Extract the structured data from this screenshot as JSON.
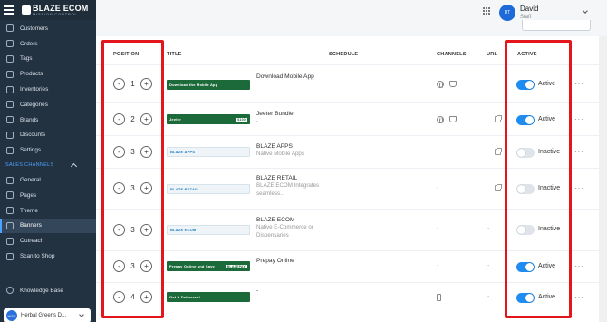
{
  "brand": {
    "name": "BLAZE ECOM",
    "tagline": "MISSION CONTROL"
  },
  "sidebar": {
    "items": [
      {
        "label": "Customers",
        "icon": "customers-icon"
      },
      {
        "label": "Orders",
        "icon": "orders-icon"
      },
      {
        "label": "Tags",
        "icon": "tag-icon"
      },
      {
        "label": "Products",
        "icon": "products-icon"
      },
      {
        "label": "Inventories",
        "icon": "inventory-icon"
      },
      {
        "label": "Categories",
        "icon": "categories-icon"
      },
      {
        "label": "Brands",
        "icon": "brands-icon"
      },
      {
        "label": "Discounts",
        "icon": "discount-icon"
      },
      {
        "label": "Settings",
        "icon": "gear-icon"
      }
    ],
    "section_label": "SALES CHANNELS",
    "channel_items": [
      {
        "label": "General",
        "icon": "general-icon"
      },
      {
        "label": "Pages",
        "icon": "pages-icon"
      },
      {
        "label": "Theme",
        "icon": "theme-icon"
      },
      {
        "label": "Banners",
        "icon": "banners-icon",
        "active": true
      },
      {
        "label": "Outreach",
        "icon": "outreach-icon"
      },
      {
        "label": "Scan to Shop",
        "icon": "scan-icon"
      }
    ],
    "knowledge_base": "Knowledge Base",
    "store": {
      "initials": "HGD",
      "name": "Herbal Greens D..."
    }
  },
  "header": {
    "user_initials": "DT",
    "user_name": "David",
    "user_role": "Staff"
  },
  "table": {
    "columns": {
      "position": "POSITION",
      "title": "TITLE",
      "schedule": "SCHEDULE",
      "channels": "CHANNELS",
      "url": "URL",
      "active": "ACTIVE"
    },
    "rows": [
      {
        "position": "1",
        "thumb_text": "Download the Mobile App",
        "title": "Download Mobile App",
        "subtitle": "",
        "schedule": "",
        "url": "-",
        "status": "Active"
      },
      {
        "position": "2",
        "thumb_text": "Jeeter",
        "thumb_badge": "$100",
        "title": "Jeeter Bundle",
        "subtitle": "-",
        "schedule": "",
        "url": "",
        "status": "Active"
      },
      {
        "position": "3",
        "thumb_text": "BLAZE APPS",
        "title": "BLAZE APPS",
        "subtitle": "Native Mobile Apps",
        "schedule": "-",
        "url": "",
        "status": "Inactive"
      },
      {
        "position": "3",
        "thumb_text": "BLAZE RETAIL",
        "title": "BLAZE RETAIL",
        "subtitle": "BLAZE ECOM Integrates seamless...",
        "schedule": "-",
        "url": "",
        "status": "Inactive"
      },
      {
        "position": "3",
        "thumb_text": "BLAZE ECOM",
        "title": "BLAZE ECOM",
        "subtitle": "Native E-Commerce or Dispensaries",
        "schedule": "-",
        "url": "-",
        "status": "Inactive"
      },
      {
        "position": "3",
        "thumb_text": "Prepay Online and Save",
        "thumb_badge": "BLAZEPAY",
        "title": "Prepay Online",
        "subtitle": "-",
        "schedule": "-",
        "url": "-",
        "status": "Active"
      },
      {
        "position": "4",
        "thumb_text": "Get it Delivered!",
        "title": "-",
        "subtitle": "-",
        "schedule": "-",
        "url": "-",
        "status": "Active"
      }
    ],
    "more_label": "···",
    "minus": "-",
    "plus": "+"
  },
  "colors": {
    "sidebar_bg": "#233241",
    "accent": "#1e8cf0",
    "highlight": "#e3161b",
    "thumb_green": "#1c6a3a"
  }
}
